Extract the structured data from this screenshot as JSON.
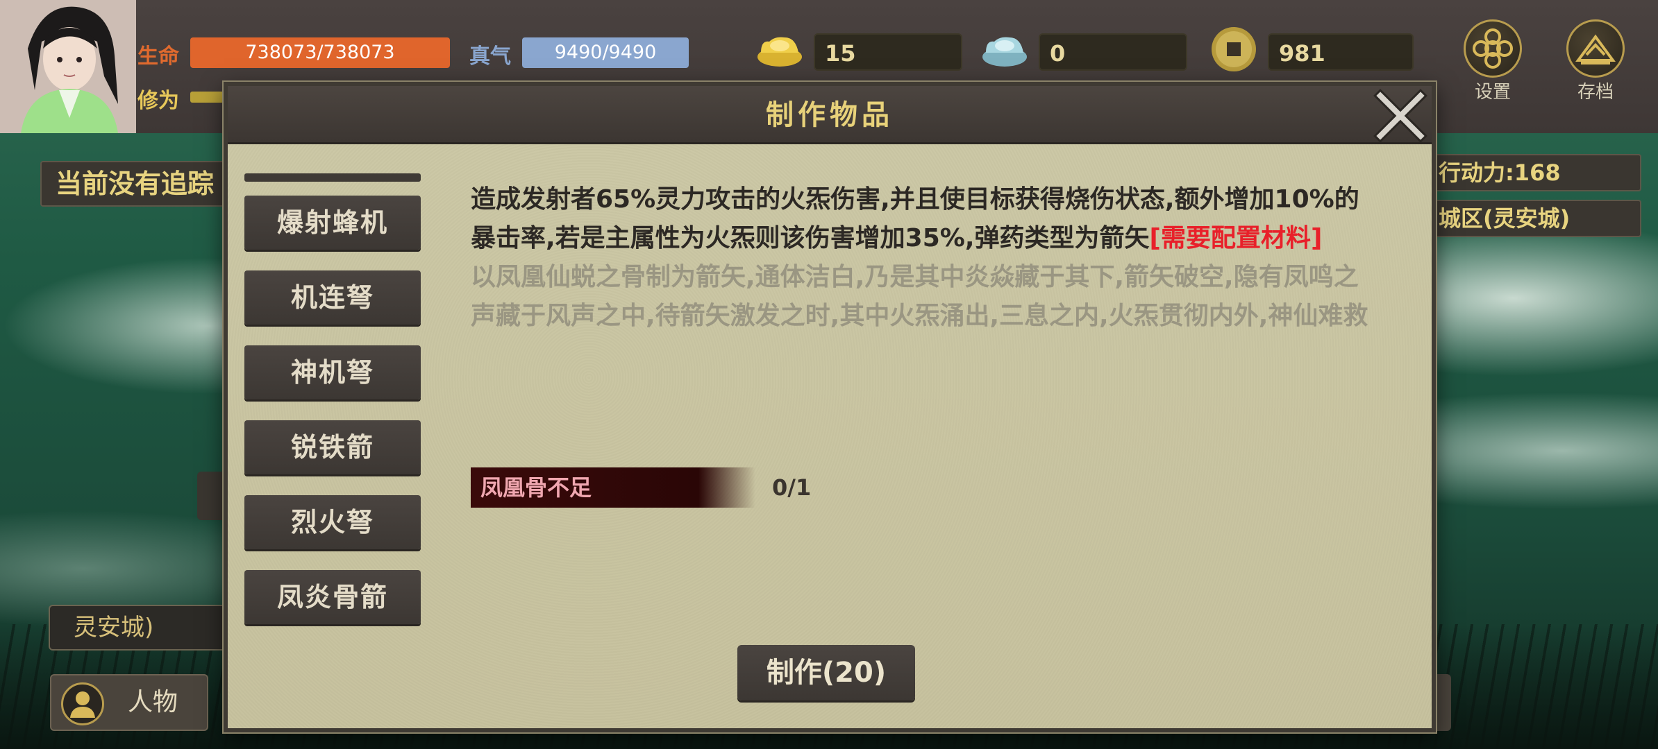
{
  "hud": {
    "hp_label": "生命",
    "hp_value": "738073/738073",
    "qi_label": "真气",
    "qi_value": "9490/9490",
    "cultivation_label": "修为",
    "gold_ingot": "15",
    "silver_ingot": "0",
    "coins": "981",
    "settings_label": "设置",
    "save_label": "存档"
  },
  "left": {
    "tracking_text": "当前没有追踪",
    "location_text": "灵安城)",
    "character_label": "人物"
  },
  "right": {
    "action_points": "行动力:168",
    "area": "城区(灵安城)"
  },
  "modal": {
    "title": "制作物品",
    "items": [
      "爆射蜂机",
      "机连弩",
      "神机弩",
      "锐铁箭",
      "烈火弩",
      "凤炎骨箭"
    ],
    "description": "造成发射者65%灵力攻击的火炁伤害,并且使目标获得烧伤状态,额外增加10%的暴击率,若是主属性为火炁则该伤害增加35%,弹药类型为箭矢",
    "need_materials": "[需要配置材料]",
    "lore": "以凤凰仙蜕之骨制为箭矢,通体洁白,乃是其中炎焱藏于其下,箭矢破空,隐有凤鸣之声藏于风声之中,待箭矢激发之时,其中火炁涌出,三息之内,火炁贯彻内外,神仙难救",
    "material_status": "凤凰骨不足",
    "material_count": "0/1",
    "make_button": "制作(20)"
  },
  "colors": {
    "hp_bar": "#e0652c",
    "qi_bar": "#8aa6cf",
    "title_gold": "#e8d27a",
    "need_red": "#e8202a",
    "panel_bg": "#c9c4a2"
  },
  "icons": {
    "gold": "gold-ingot-icon",
    "silver": "silver-ingot-icon",
    "coin": "copper-coin-icon",
    "settings": "settings-flower-icon",
    "save": "save-mountain-icon",
    "close": "close-x-icon",
    "character": "person-icon"
  }
}
